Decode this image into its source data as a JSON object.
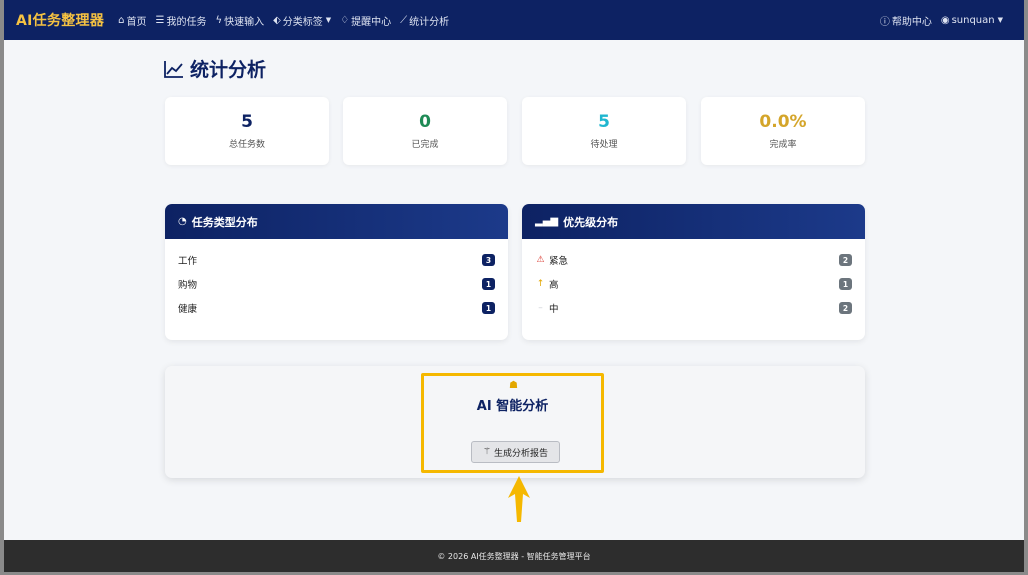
{
  "navbar": {
    "brand": "AI任务整理器",
    "items": [
      {
        "icon": "home-icon",
        "label": "首页"
      },
      {
        "icon": "list-icon",
        "label": "我的任务"
      },
      {
        "icon": "lightning-icon",
        "label": "快速输入"
      },
      {
        "icon": "tag-icon",
        "label": "分类标签"
      },
      {
        "icon": "bell-icon",
        "label": "提醒中心"
      },
      {
        "icon": "chart-icon",
        "label": "统计分析"
      }
    ],
    "help": "帮助中心",
    "user": "sunquan"
  },
  "page": {
    "title": "统计分析"
  },
  "stats": [
    {
      "value": "5",
      "label": "总任务数",
      "color": "#0d2263"
    },
    {
      "value": "0",
      "label": "已完成",
      "color": "#1e8a55"
    },
    {
      "value": "5",
      "label": "待处理",
      "color": "#1fb6cf"
    },
    {
      "value": "0.0%",
      "label": "完成率",
      "color": "#d4a52a"
    }
  ],
  "type_panel": {
    "title": "任务类型分布",
    "rows": [
      {
        "label": "工作",
        "count": "3"
      },
      {
        "label": "购物",
        "count": "1"
      },
      {
        "label": "健康",
        "count": "1"
      }
    ]
  },
  "priority_panel": {
    "title": "优先级分布",
    "rows": [
      {
        "icon": "warning-icon",
        "label": "紧急",
        "count": "2"
      },
      {
        "icon": "arrow-up-icon",
        "label": "高",
        "count": "1"
      },
      {
        "icon": "dash-icon",
        "label": "中",
        "count": "2"
      }
    ]
  },
  "ai": {
    "title": "AI 智能分析",
    "button": "生成分析报告"
  },
  "footer": {
    "text": "© 2026 AI任务整理器 - 智能任务管理平台"
  }
}
